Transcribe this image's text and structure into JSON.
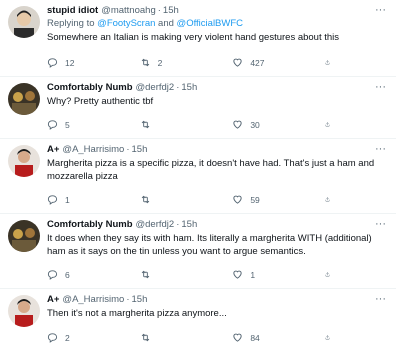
{
  "colors": {
    "link": "#1d9bf0",
    "secondary": "#536471",
    "text": "#0f1419",
    "divider": "#eff3f4"
  },
  "tweets": [
    {
      "name": "stupid idiot",
      "handle": "@mattnoahg",
      "time": "15h",
      "reply_prefix": "Replying to ",
      "reply_mention1": "@FootyScran",
      "reply_and": " and ",
      "reply_mention2": "@OfficialBWFC",
      "text": "Somewhere an Italian is making very violent hand gestures about this",
      "reply_count": "12",
      "retweet_count": "2",
      "like_count": "427",
      "more": "···"
    },
    {
      "name": "Comfortably Numb",
      "handle": "@derfdj2",
      "time": "15h",
      "text": "Why? Pretty authentic tbf",
      "reply_count": "5",
      "retweet_count": "",
      "like_count": "30",
      "more": "···"
    },
    {
      "name": "A+",
      "handle": "@A_Harrisimo",
      "time": "15h",
      "text": "Margherita pizza is a specific pizza, it doesn't have had. That's just a ham and mozzarella pizza",
      "reply_count": "1",
      "retweet_count": "",
      "like_count": "59",
      "more": "···"
    },
    {
      "name": "Comfortably Numb",
      "handle": "@derfdj2",
      "time": "15h",
      "text": "It does when they say its with ham. Its literally a margherita WITH (additional) ham as it says on the tin unless you want to argue semantics.",
      "reply_count": "6",
      "retweet_count": "",
      "like_count": "1",
      "more": "···"
    },
    {
      "name": "A+",
      "handle": "@A_Harrisimo",
      "time": "15h",
      "text": "Then it's not a margherita pizza anymore...",
      "reply_count": "2",
      "retweet_count": "",
      "like_count": "84",
      "more": "···"
    }
  ]
}
